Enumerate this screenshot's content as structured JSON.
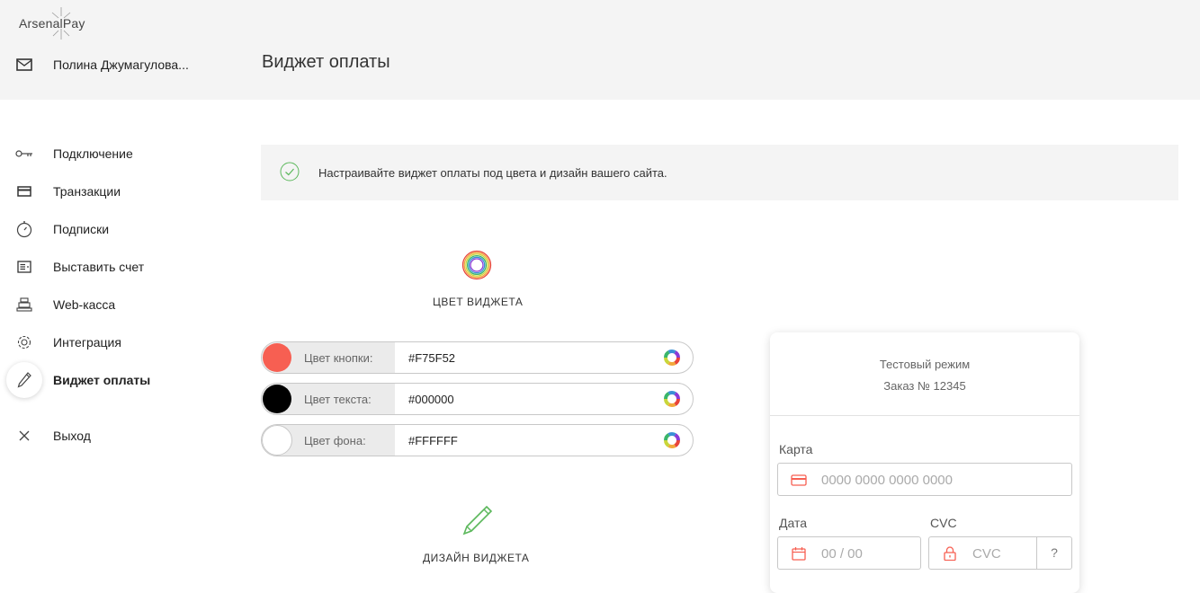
{
  "header": {
    "logo": "ArsenalPay",
    "user_name": "Полина Джумагулова...",
    "page_title": "Виджет оплаты"
  },
  "nav": {
    "items": [
      {
        "label": "Подключение",
        "icon": "key-icon"
      },
      {
        "label": "Транзакции",
        "icon": "card-icon"
      },
      {
        "label": "Подписки",
        "icon": "stopwatch-icon"
      },
      {
        "label": "Выставить счет",
        "icon": "invoice-icon"
      },
      {
        "label": "Web-касса",
        "icon": "cash-register-icon"
      },
      {
        "label": "Интеграция",
        "icon": "gear-icon"
      },
      {
        "label": "Виджет оплаты",
        "icon": "pencil-icon",
        "active": true
      }
    ],
    "logout": "Выход"
  },
  "banner": {
    "text": "Настраивайте виджет оплаты под цвета и дизайн вашего сайта."
  },
  "widget_color": {
    "title": "ЦВЕТ ВИДЖЕТА",
    "rows": [
      {
        "label": "Цвет кнопки:",
        "value": "#F75F52",
        "swatch": "#F75F52"
      },
      {
        "label": "Цвет текста:",
        "value": "#000000",
        "swatch": "#000000"
      },
      {
        "label": "Цвет фона:",
        "value": "#FFFFFF",
        "swatch": "#FFFFFF"
      }
    ]
  },
  "widget_design": {
    "title": "ДИЗАЙН ВИДЖЕТА"
  },
  "preview": {
    "mode": "Тестовый режим",
    "order": "Заказ № 12345",
    "card_label": "Карта",
    "card_placeholder": "0000 0000 0000 0000",
    "date_label": "Дата",
    "date_placeholder": "00 / 00",
    "cvc_label": "CVC",
    "cvc_placeholder": "CVC",
    "cvc_help": "?"
  },
  "colors": {
    "accent_red": "#F75F52",
    "green": "#5cb85c"
  }
}
